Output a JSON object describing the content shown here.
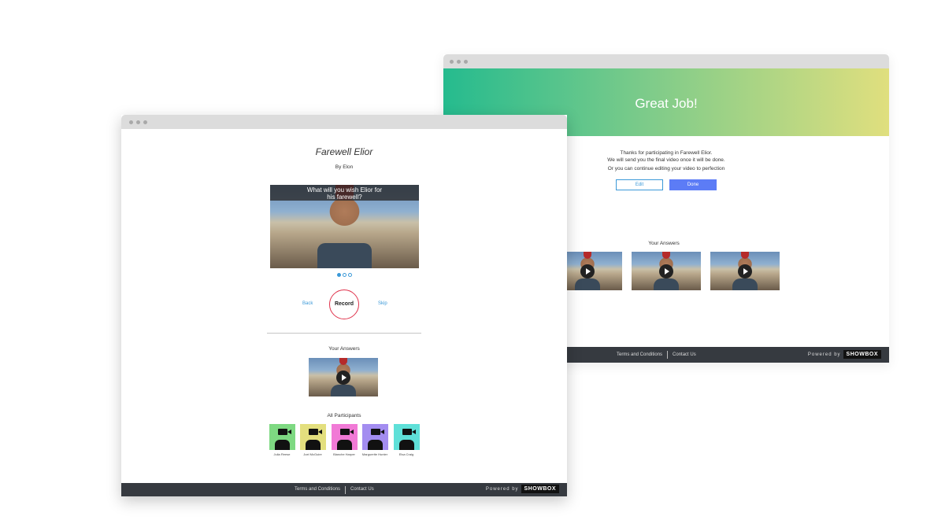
{
  "back_window": {
    "banner_title": "Great Job!",
    "thanks_line1": "Thanks for participating in Farewell Elior.",
    "thanks_line2": "We will send you the final video once it will be done.",
    "thanks_line3": "Or you can continue editing your video to perfection",
    "edit_label": "Edit",
    "done_label": "Done",
    "answers_title": "Your Answers",
    "footer": {
      "terms": "Terms and Conditions",
      "contact": "Contact Us",
      "powered": "Powered by",
      "brand": "SHOWBOX"
    }
  },
  "front_window": {
    "title": "Farewell Elior",
    "subtitle": "By Elon",
    "question_line1": "What will you wish Elior for",
    "question_line2": "his farewell?",
    "back_label": "Back",
    "record_label": "Record",
    "skip_label": "Skip",
    "answers_title": "Your Answers",
    "participants_title": "All Participants",
    "participants": [
      {
        "name": "Julia Reese",
        "color": "#7ed982"
      },
      {
        "name": "Joel McGuire",
        "color": "#e3df7e"
      },
      {
        "name": "Blanche Harper",
        "color": "#f17ad6"
      },
      {
        "name": "Marguerite Hunter",
        "color": "#a38df0"
      },
      {
        "name": "Elsa Craig",
        "color": "#5fe0d8"
      }
    ],
    "footer": {
      "terms": "Terms and Conditions",
      "contact": "Contact Us",
      "powered": "Powered by",
      "brand": "SHOWBOX"
    }
  }
}
